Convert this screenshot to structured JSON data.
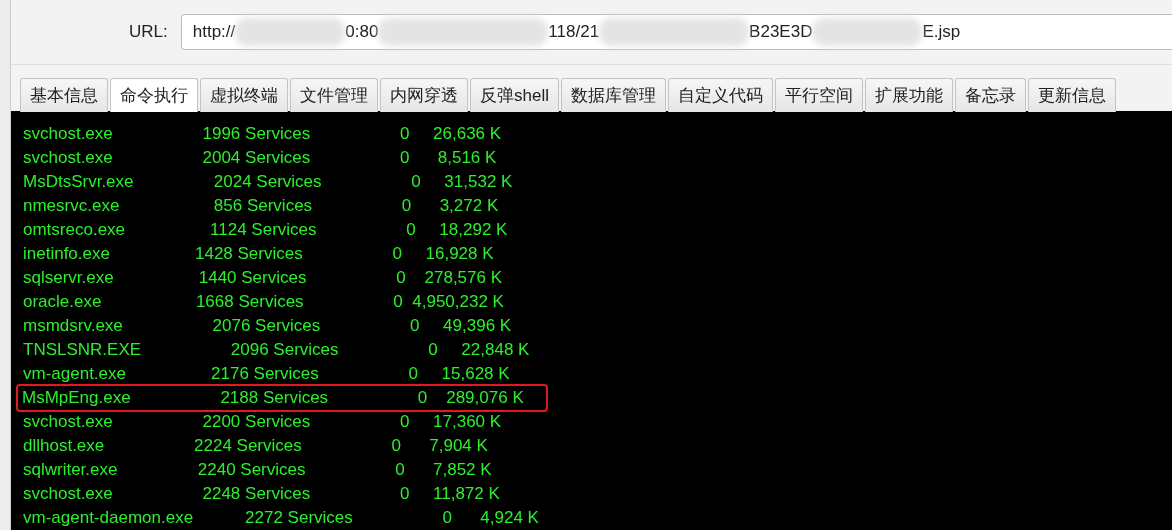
{
  "url_bar": {
    "label": "URL:",
    "segments": [
      {
        "kind": "text",
        "text": "http://"
      },
      {
        "kind": "redacted"
      },
      {
        "kind": "text",
        "text": "0:80"
      },
      {
        "kind": "redacted"
      },
      {
        "kind": "text",
        "text": "118/21"
      },
      {
        "kind": "redacted"
      },
      {
        "kind": "text",
        "text": "B23E3D"
      },
      {
        "kind": "redacted"
      },
      {
        "kind": "text",
        "text": "E.jsp"
      }
    ]
  },
  "tabs": [
    {
      "label": "基本信息",
      "selected": false
    },
    {
      "label": "命令执行",
      "selected": true
    },
    {
      "label": "虚拟终端",
      "selected": false
    },
    {
      "label": "文件管理",
      "selected": false
    },
    {
      "label": "内网穿透",
      "selected": false
    },
    {
      "label": "反弹shell",
      "selected": false
    },
    {
      "label": "数据库管理",
      "selected": false
    },
    {
      "label": "自定义代码",
      "selected": false
    },
    {
      "label": "平行空间",
      "selected": false
    },
    {
      "label": "扩展功能",
      "selected": false
    },
    {
      "label": "备忘录",
      "selected": false
    },
    {
      "label": "更新信息",
      "selected": false
    }
  ],
  "console": {
    "rows": [
      {
        "text": "svchost.exe                   1996 Services                   0     26,636 K",
        "highlighted": false
      },
      {
        "text": "svchost.exe                   2004 Services                   0      8,516 K",
        "highlighted": false
      },
      {
        "text": "MsDtsSrvr.exe                 2024 Services                   0     31,532 K",
        "highlighted": false
      },
      {
        "text": "nmesrvc.exe                    856 Services                   0      3,272 K",
        "highlighted": false
      },
      {
        "text": "omtsreco.exe                  1124 Services                   0     18,292 K",
        "highlighted": false
      },
      {
        "text": "inetinfo.exe                  1428 Services                   0     16,928 K",
        "highlighted": false
      },
      {
        "text": "sqlservr.exe                  1440 Services                   0    278,576 K",
        "highlighted": false
      },
      {
        "text": "oracle.exe                    1668 Services                   0  4,950,232 K",
        "highlighted": false
      },
      {
        "text": "msmdsrv.exe                   2076 Services                   0     49,396 K",
        "highlighted": false
      },
      {
        "text": "TNSLSNR.EXE                   2096 Services                   0     22,848 K",
        "highlighted": false
      },
      {
        "text": "vm-agent.exe                  2176 Services                   0     15,628 K",
        "highlighted": false
      },
      {
        "text": "MsMpEng.exe                   2188 Services                   0    289,076 K",
        "highlighted": true
      },
      {
        "text": "svchost.exe                   2200 Services                   0     17,360 K",
        "highlighted": false
      },
      {
        "text": "dllhost.exe                   2224 Services                   0      7,904 K",
        "highlighted": false
      },
      {
        "text": "sqlwriter.exe                 2240 Services                   0      7,852 K",
        "highlighted": false
      },
      {
        "text": "svchost.exe                   2248 Services                   0     11,872 K",
        "highlighted": false
      },
      {
        "text": "vm-agent-daemon.exe           2272 Services                   0      4,924 K",
        "highlighted": false
      }
    ]
  }
}
